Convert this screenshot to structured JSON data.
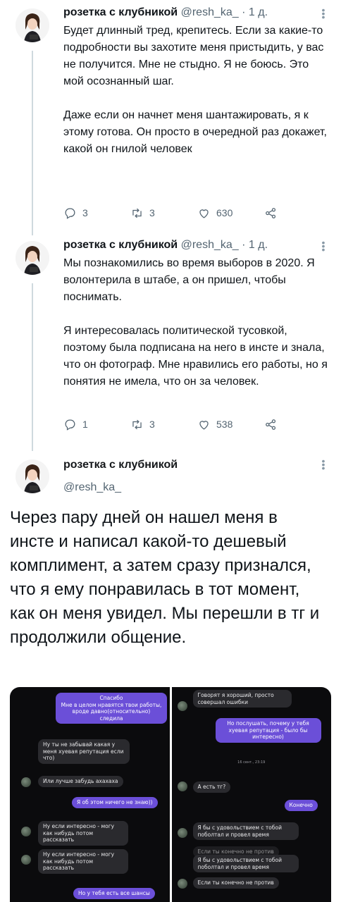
{
  "author": {
    "name": "розетка с клубникой",
    "handle": "@resh_ka_",
    "time": "· 1 д."
  },
  "tweets": [
    {
      "paragraphs": [
        "Будет длинный тред, крепитесь. Если за какие-то подробности вы захотите меня пристыдить, у вас не получится. Мне не стыдно. Я не боюсь. Это мой осознанный шаг.",
        "Даже если он начнет меня шантажировать, я к этому готова. Он просто в очередной раз докажет, какой он гнилой человек"
      ],
      "replies": "3",
      "retweets": "3",
      "likes": "630"
    },
    {
      "paragraphs": [
        "Мы познакомились во время выборов в 2020. Я волонтерила в штабе, а он пришел, чтобы поснимать.",
        "Я интересовалась политической тусовкой, поэтому была подписана на него в инсте и знала, что он фотограф. Мне нравились его работы, но я понятия не имела, что он за человек."
      ],
      "replies": "1",
      "retweets": "3",
      "likes": "538"
    }
  ],
  "main_tweet": {
    "name": "розетка с клубникой",
    "handle": "@resh_ka_",
    "text": "Через пару дней он нашел меня в инсте и написал какой-то дешевый комплимент, а затем сразу признался, что я ему понравилась в тот момент, как он меня увидел. Мы перешли в тг и продолжили общение."
  },
  "screenshot_left": {
    "messages": [
      "Спасибо\nМне в целом нравятся твои работы, вроде давно(относительно) следила",
      "Ну ты не забывай какая у меня хуевая репутация если что)",
      "Или лучше забудь ахахаха",
      "Я об этом ничего не знаю))",
      "Ну если интересно - могу как нибудь потом рассказать",
      "Ну если интересно - могу как нибудь потом рассказать",
      "Но у тебя есть все шансы"
    ]
  },
  "screenshot_right": {
    "messages": [
      "Говорят я хороший, просто совершал ошибки",
      "Но послушать, почему у тебя хуевая репутация - было бы интересно)",
      "16 сент., 23:19",
      "А есть тг?",
      "Конечно",
      "Я бы с удовольствием с тобой поболтал и провел время",
      "Если ты конечно не против",
      "Я бы с удовольствием с тобой поболтал и провел время",
      "Если ты конечно не против"
    ]
  },
  "colors": {
    "text": "#0f1419",
    "muted": "#536471",
    "chat_bg": "#0b0b0d",
    "bubble_out": "#6b4fd8",
    "bubble_in": "#2a2a2e"
  },
  "icons": [
    "reply-icon",
    "retweet-icon",
    "like-icon",
    "share-icon",
    "more-icon"
  ]
}
